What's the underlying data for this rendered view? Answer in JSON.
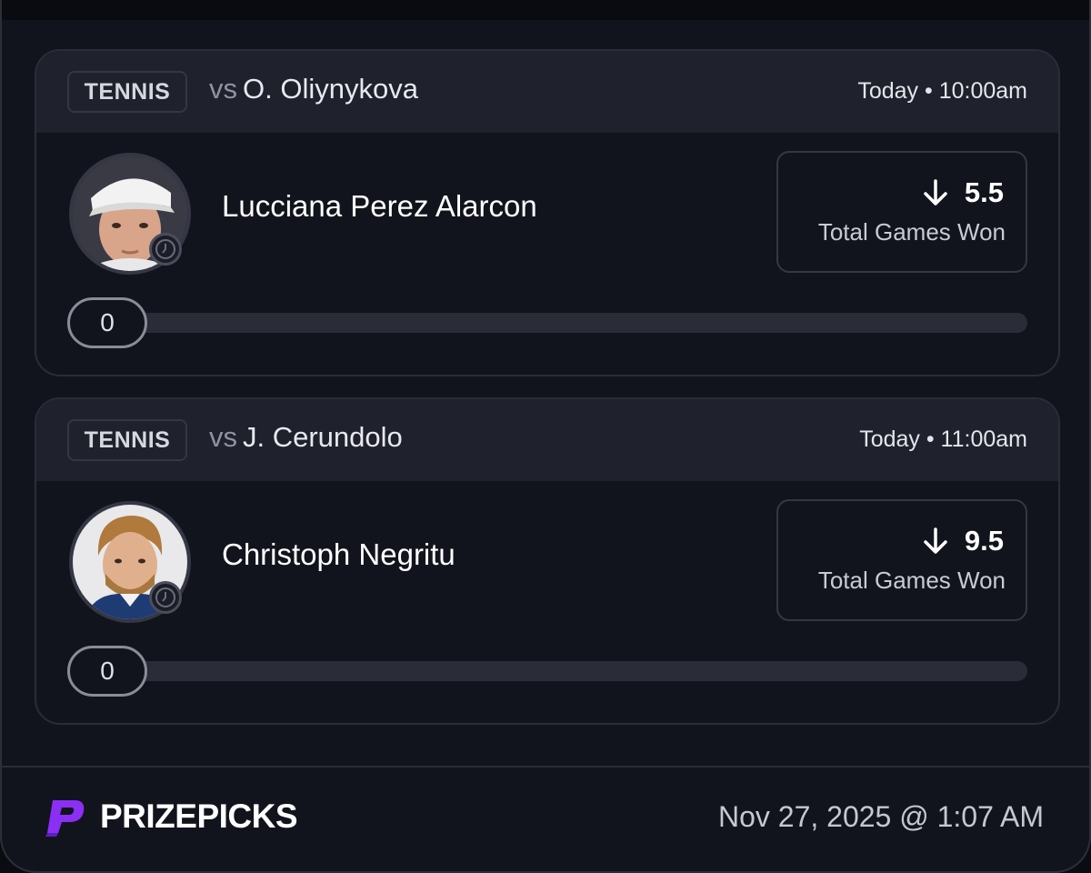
{
  "cards": [
    {
      "sport": "TENNIS",
      "vs_label": "vs",
      "opponent": "O. Oliynykova",
      "game_time": "Today • 10:00am",
      "player_name": "Lucciana Perez Alarcon",
      "projection_value": "5.5",
      "projection_direction": "down-arrow-icon",
      "stat_type": "Total Games Won",
      "current_value": "0",
      "progress_fraction": 0
    },
    {
      "sport": "TENNIS",
      "vs_label": "vs",
      "opponent": "J. Cerundolo",
      "game_time": "Today • 11:00am",
      "player_name": "Christoph Negritu",
      "projection_value": "9.5",
      "projection_direction": "down-arrow-icon",
      "stat_type": "Total Games Won",
      "current_value": "0",
      "progress_fraction": 0
    }
  ],
  "footer": {
    "brand_name": "PRIZEPICKS",
    "timestamp": "Nov 27, 2025 @ 1:07 AM"
  },
  "colors": {
    "background": "#12141d",
    "card_header": "#1f212c",
    "brand_purple": "#8b2ff5"
  }
}
